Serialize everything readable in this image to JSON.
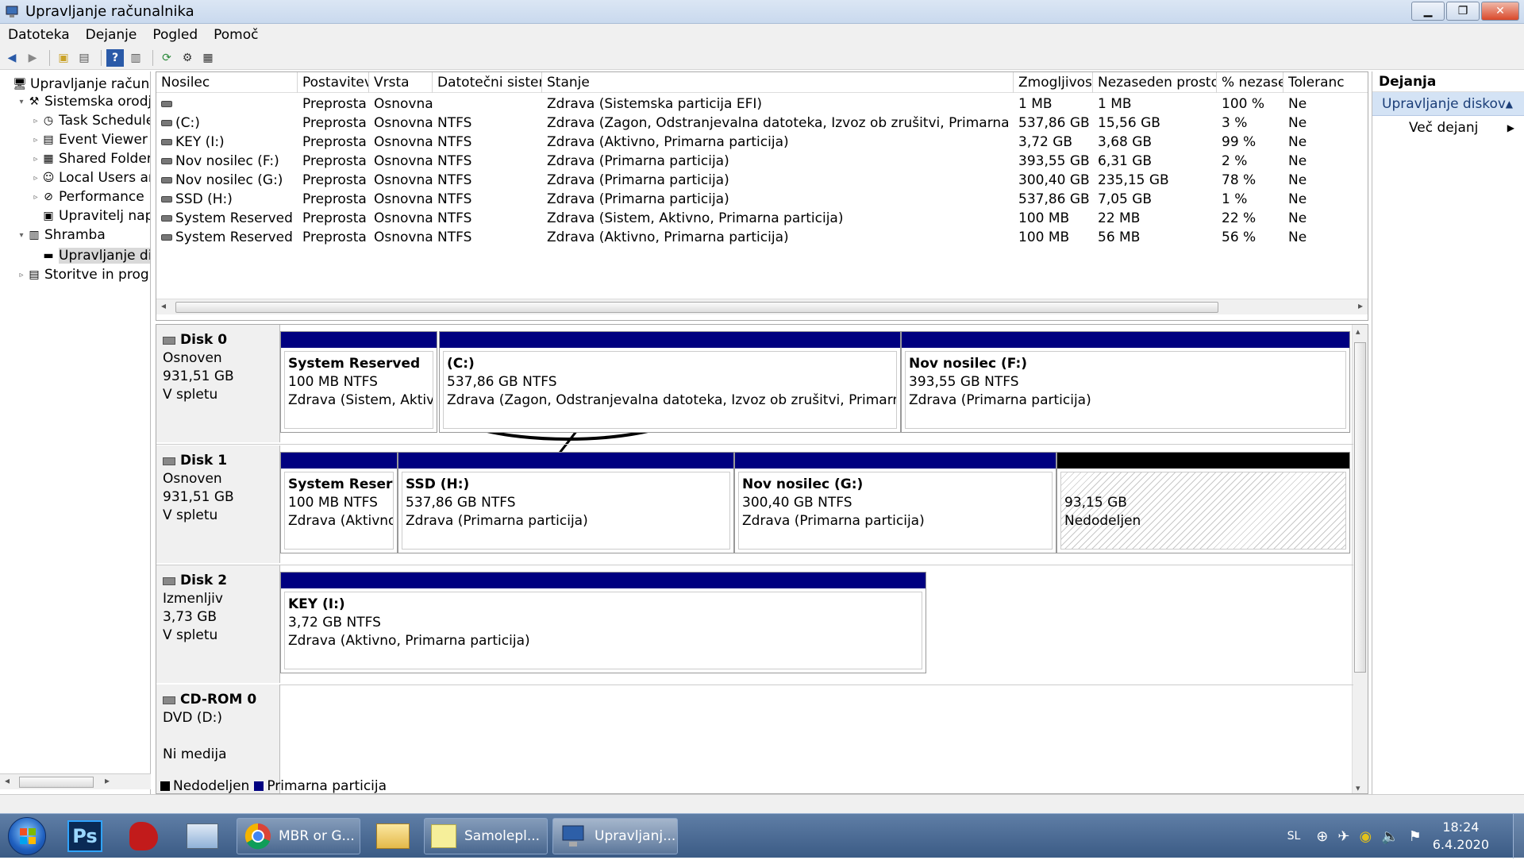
{
  "window": {
    "title": "Upravljanje računalnika"
  },
  "menu": [
    "Datoteka",
    "Dejanje",
    "Pogled",
    "Pomoč"
  ],
  "tree": [
    {
      "label": "Upravljanje računalni",
      "level": 0,
      "icon": "computer-icon",
      "twisty": ""
    },
    {
      "label": "Sistemska orodja",
      "level": 1,
      "icon": "tools-icon",
      "twisty": "▾"
    },
    {
      "label": "Task Scheduler",
      "level": 2,
      "icon": "clock-icon",
      "twisty": "▹"
    },
    {
      "label": "Event Viewer",
      "level": 2,
      "icon": "event-viewer-icon",
      "twisty": "▹"
    },
    {
      "label": "Shared Folders",
      "level": 2,
      "icon": "shared-folder-icon",
      "twisty": "▹"
    },
    {
      "label": "Local Users and",
      "level": 2,
      "icon": "users-icon",
      "twisty": "▹"
    },
    {
      "label": "Performance",
      "level": 2,
      "icon": "performance-icon",
      "twisty": "▹"
    },
    {
      "label": "Upravitelj naprav",
      "level": 2,
      "icon": "device-manager-icon",
      "twisty": ""
    },
    {
      "label": "Shramba",
      "level": 1,
      "icon": "storage-icon",
      "twisty": "▾"
    },
    {
      "label": "Upravljanje disko",
      "level": 2,
      "icon": "disk-management-icon",
      "twisty": "",
      "selected": true
    },
    {
      "label": "Storitve in program",
      "level": 1,
      "icon": "services-icon",
      "twisty": "▹"
    }
  ],
  "volume_table": {
    "headers": [
      "Nosilec",
      "Postavitev",
      "Vrsta",
      "Datotečni sistem",
      "Stanje",
      "Zmogljivost",
      "Nezaseden prostor",
      "% nezasedeno",
      "Toleranc"
    ],
    "rows": [
      [
        "",
        "Preprosta",
        "Osnovna",
        "",
        "Zdrava (Sistemska particija EFI)",
        "1 MB",
        "1 MB",
        "100 %",
        "Ne"
      ],
      [
        "(C:)",
        "Preprosta",
        "Osnovna",
        "NTFS",
        "Zdrava (Zagon, Odstranjevalna datoteka, Izvoz ob zrušitvi, Primarna particija)",
        "537,86 GB",
        "15,56 GB",
        "3 %",
        "Ne"
      ],
      [
        "KEY (I:)",
        "Preprosta",
        "Osnovna",
        "NTFS",
        "Zdrava (Aktivno, Primarna particija)",
        "3,72 GB",
        "3,68 GB",
        "99 %",
        "Ne"
      ],
      [
        "Nov nosilec (F:)",
        "Preprosta",
        "Osnovna",
        "NTFS",
        "Zdrava (Primarna particija)",
        "393,55 GB",
        "6,31 GB",
        "2 %",
        "Ne"
      ],
      [
        "Nov nosilec (G:)",
        "Preprosta",
        "Osnovna",
        "NTFS",
        "Zdrava (Primarna particija)",
        "300,40 GB",
        "235,15 GB",
        "78 %",
        "Ne"
      ],
      [
        "SSD (H:)",
        "Preprosta",
        "Osnovna",
        "NTFS",
        "Zdrava (Primarna particija)",
        "537,86 GB",
        "7,05 GB",
        "1 %",
        "Ne"
      ],
      [
        "System Reserved",
        "Preprosta",
        "Osnovna",
        "NTFS",
        "Zdrava (Sistem, Aktivno, Primarna particija)",
        "100 MB",
        "22 MB",
        "22 %",
        "Ne"
      ],
      [
        "System Reserved (E:)",
        "Preprosta",
        "Osnovna",
        "NTFS",
        "Zdrava (Aktivno, Primarna particija)",
        "100 MB",
        "56 MB",
        "56 %",
        "Ne"
      ]
    ]
  },
  "disks": [
    {
      "name": "Disk 0",
      "type": "Osnoven",
      "size": "931,51 GB",
      "status": "V spletu",
      "parts": [
        {
          "title": "System Reserved",
          "size": "100 MB NTFS",
          "status": "Zdrava (Sistem, Aktivno,"
        },
        {
          "title": "(C:)",
          "size": "537,86 GB NTFS",
          "status": "Zdrava (Zagon, Odstranjevalna datoteka, Izvoz ob zrušitvi, Primarna partic"
        },
        {
          "title": "Nov nosilec  (F:)",
          "size": "393,55 GB NTFS",
          "status": "Zdrava (Primarna particija)"
        }
      ]
    },
    {
      "name": "Disk 1",
      "type": "Osnoven",
      "size": "931,51 GB",
      "status": "V spletu",
      "parts": [
        {
          "title": "System Reserved",
          "size": "100 MB NTFS",
          "status": "Zdrava (Aktivno, P"
        },
        {
          "title": "SSD  (H:)",
          "size": "537,86 GB NTFS",
          "status": "Zdrava (Primarna particija)"
        },
        {
          "title": "Nov nosilec  (G:)",
          "size": "300,40 GB NTFS",
          "status": "Zdrava (Primarna particija)"
        },
        {
          "title": "",
          "size": "93,15 GB",
          "status": "Nedodeljen"
        }
      ]
    },
    {
      "name": "Disk 2",
      "type": "Izmenljiv",
      "size": "3,73 GB",
      "status": "V spletu",
      "parts": [
        {
          "title": "KEY  (I:)",
          "size": "3,72 GB NTFS",
          "status": "Zdrava (Aktivno, Primarna particija)"
        }
      ]
    },
    {
      "name": "CD-ROM 0",
      "type": "DVD (D:)",
      "size": "",
      "status": "Ni medija",
      "parts": []
    }
  ],
  "legend": {
    "unallocated": "Nedodeljen",
    "primary": "Primarna particija"
  },
  "actions": {
    "header": "Dejanja",
    "section": "Upravljanje diskov",
    "more": "Več dejanj"
  },
  "taskbar": {
    "tasks": [
      {
        "label": "MBR or G..."
      },
      {
        "label": "Samolepl..."
      },
      {
        "label": "Upravljanj..."
      }
    ],
    "lang": "SL",
    "time": "18:24",
    "date": "6.4.2020"
  },
  "colors": {
    "primary_partition": "#000080",
    "unallocated": "#000000",
    "selection": "#d4e3f5"
  }
}
